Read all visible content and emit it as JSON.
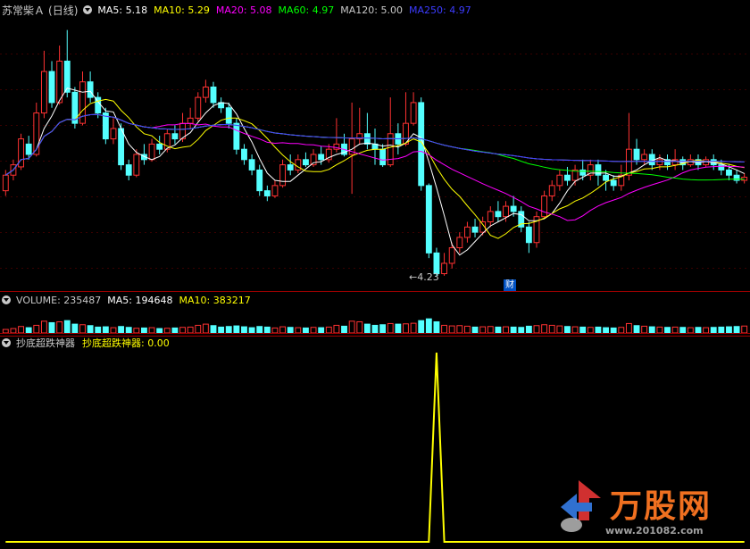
{
  "header": {
    "stock_name": "苏常柴Ａ",
    "period": "(日线)",
    "ma_items": [
      {
        "label": "MA5: 5.18",
        "color": "#ffffff"
      },
      {
        "label": "MA10: 5.29",
        "color": "#ffff00"
      },
      {
        "label": "MA20: 5.08",
        "color": "#ff00ff"
      },
      {
        "label": "MA60: 4.97",
        "color": "#00ff00"
      },
      {
        "label": "MA120: 5.00",
        "color": "#c8c8c8"
      },
      {
        "label": "MA250: 4.97",
        "color": "#3c3cff"
      }
    ]
  },
  "volume_panel": {
    "items": [
      {
        "label": "VOLUME: 235487",
        "color": "#c8c8c8"
      },
      {
        "label": "MA5: 194648",
        "color": "#ffffff"
      },
      {
        "label": "MA10: 383217",
        "color": "#ffff00"
      }
    ]
  },
  "indicator_panel": {
    "name": "抄底超跌神器",
    "value_label": "抄底超跌神器: 0.00",
    "color": "#ffff00"
  },
  "annotations": {
    "low_marker": "4.23",
    "finance_badge": "财"
  },
  "watermark": {
    "brand": "万股网",
    "url": "www.201082.com"
  },
  "chart_data": {
    "type": "candlestick",
    "price_range": [
      4.1,
      6.7
    ],
    "candles": [
      [
        5.05,
        5.2,
        5.0,
        5.25
      ],
      [
        5.2,
        5.3,
        5.15,
        5.35
      ],
      [
        5.28,
        5.55,
        5.25,
        5.6
      ],
      [
        5.5,
        5.4,
        5.35,
        5.58
      ],
      [
        5.4,
        5.8,
        5.38,
        5.9
      ],
      [
        5.8,
        6.2,
        5.75,
        6.4
      ],
      [
        6.2,
        5.9,
        5.85,
        6.3
      ],
      [
        5.9,
        6.3,
        5.88,
        6.45
      ],
      [
        6.3,
        6.0,
        5.95,
        6.6
      ],
      [
        6.0,
        5.7,
        5.65,
        6.05
      ],
      [
        5.7,
        6.1,
        5.68,
        6.2
      ],
      [
        6.1,
        5.95,
        5.9,
        6.2
      ],
      [
        5.95,
        5.8,
        5.75,
        6.0
      ],
      [
        5.8,
        5.55,
        5.5,
        5.85
      ],
      [
        5.55,
        5.65,
        5.5,
        5.75
      ],
      [
        5.65,
        5.3,
        5.25,
        5.7
      ],
      [
        5.3,
        5.2,
        5.15,
        5.35
      ],
      [
        5.2,
        5.4,
        5.18,
        5.45
      ],
      [
        5.4,
        5.35,
        5.3,
        5.5
      ],
      [
        5.35,
        5.5,
        5.33,
        5.55
      ],
      [
        5.5,
        5.45,
        5.4,
        5.58
      ],
      [
        5.45,
        5.6,
        5.42,
        5.65
      ],
      [
        5.6,
        5.55,
        5.5,
        5.68
      ],
      [
        5.55,
        5.7,
        5.52,
        5.8
      ],
      [
        5.7,
        5.75,
        5.65,
        5.85
      ],
      [
        5.75,
        5.95,
        5.72,
        6.0
      ],
      [
        5.95,
        6.05,
        5.9,
        6.12
      ],
      [
        6.05,
        5.9,
        5.85,
        6.1
      ],
      [
        5.9,
        5.85,
        5.8,
        5.95
      ],
      [
        5.85,
        5.7,
        5.65,
        5.9
      ],
      [
        5.7,
        5.45,
        5.4,
        5.75
      ],
      [
        5.45,
        5.35,
        5.3,
        5.5
      ],
      [
        5.35,
        5.25,
        5.2,
        5.4
      ],
      [
        5.25,
        5.05,
        5.0,
        5.3
      ],
      [
        5.05,
        5.0,
        4.95,
        5.1
      ],
      [
        5.0,
        5.1,
        4.98,
        5.15
      ],
      [
        5.1,
        5.3,
        5.08,
        5.35
      ],
      [
        5.3,
        5.25,
        5.2,
        5.4
      ],
      [
        5.25,
        5.35,
        5.22,
        5.4
      ],
      [
        5.35,
        5.3,
        5.28,
        5.42
      ],
      [
        5.3,
        5.4,
        5.28,
        5.45
      ],
      [
        5.4,
        5.35,
        5.3,
        5.48
      ],
      [
        5.35,
        5.45,
        5.32,
        5.5
      ],
      [
        5.45,
        5.5,
        5.42,
        5.75
      ],
      [
        5.5,
        5.4,
        5.38,
        5.6
      ],
      [
        5.4,
        5.55,
        5.02,
        5.9
      ],
      [
        5.55,
        5.6,
        5.5,
        5.85
      ],
      [
        5.6,
        5.5,
        5.45,
        5.8
      ],
      [
        5.5,
        5.45,
        5.3,
        5.65
      ],
      [
        5.45,
        5.3,
        5.28,
        5.5
      ],
      [
        5.3,
        5.6,
        5.28,
        5.95
      ],
      [
        5.6,
        5.5,
        5.4,
        5.7
      ],
      [
        5.5,
        5.7,
        5.48,
        6.0
      ],
      [
        5.7,
        5.9,
        5.68,
        6.0
      ],
      [
        5.9,
        5.1,
        5.05,
        5.95
      ],
      [
        5.1,
        4.45,
        4.4,
        5.12
      ],
      [
        4.45,
        4.25,
        4.23,
        4.5
      ],
      [
        4.25,
        4.35,
        4.23,
        4.45
      ],
      [
        4.35,
        4.5,
        4.3,
        4.55
      ],
      [
        4.5,
        4.6,
        4.45,
        4.65
      ],
      [
        4.6,
        4.7,
        4.55,
        4.75
      ],
      [
        4.7,
        4.65,
        4.6,
        4.78
      ],
      [
        4.65,
        4.75,
        4.62,
        4.8
      ],
      [
        4.75,
        4.85,
        4.7,
        4.9
      ],
      [
        4.85,
        4.8,
        4.75,
        4.95
      ],
      [
        4.8,
        4.9,
        4.75,
        4.95
      ],
      [
        4.9,
        4.85,
        4.8,
        5.0
      ],
      [
        4.85,
        4.7,
        4.65,
        4.9
      ],
      [
        4.7,
        4.55,
        4.45,
        4.75
      ],
      [
        4.55,
        4.8,
        4.5,
        4.85
      ],
      [
        4.8,
        5.0,
        4.78,
        5.05
      ],
      [
        5.0,
        5.1,
        4.95,
        5.15
      ],
      [
        5.1,
        5.2,
        5.05,
        5.25
      ],
      [
        5.2,
        5.15,
        5.1,
        5.28
      ],
      [
        5.15,
        5.25,
        5.1,
        5.3
      ],
      [
        5.25,
        5.2,
        5.15,
        5.35
      ],
      [
        5.2,
        5.3,
        5.15,
        5.35
      ],
      [
        5.3,
        5.2,
        5.1,
        5.35
      ],
      [
        5.2,
        5.15,
        5.05,
        5.25
      ],
      [
        5.15,
        5.1,
        5.05,
        5.2
      ],
      [
        5.1,
        5.2,
        5.05,
        5.3
      ],
      [
        5.2,
        5.45,
        5.15,
        5.8
      ],
      [
        5.45,
        5.35,
        5.3,
        5.55
      ],
      [
        5.35,
        5.4,
        5.3,
        5.45
      ],
      [
        5.4,
        5.3,
        5.25,
        5.45
      ],
      [
        5.3,
        5.35,
        5.25,
        5.4
      ],
      [
        5.35,
        5.3,
        5.25,
        5.4
      ],
      [
        5.3,
        5.35,
        5.25,
        5.45
      ],
      [
        5.35,
        5.3,
        5.25,
        5.38
      ],
      [
        5.3,
        5.35,
        5.28,
        5.4
      ],
      [
        5.35,
        5.3,
        5.25,
        5.4
      ],
      [
        5.3,
        5.35,
        5.28,
        5.38
      ],
      [
        5.35,
        5.3,
        5.25,
        5.4
      ],
      [
        5.3,
        5.25,
        5.2,
        5.35
      ],
      [
        5.25,
        5.2,
        5.15,
        5.3
      ],
      [
        5.2,
        5.15,
        5.12,
        5.25
      ],
      [
        5.15,
        5.18,
        5.12,
        5.22
      ]
    ],
    "volume_range": [
      0,
      1000000
    ],
    "volumes": [
      120000,
      150000,
      220000,
      180000,
      260000,
      400000,
      350000,
      380000,
      420000,
      300000,
      280000,
      250000,
      200000,
      210000,
      180000,
      220000,
      190000,
      160000,
      170000,
      180000,
      150000,
      160000,
      170000,
      190000,
      200000,
      260000,
      300000,
      250000,
      200000,
      220000,
      240000,
      210000,
      180000,
      220000,
      200000,
      170000,
      210000,
      190000,
      180000,
      170000,
      190000,
      180000,
      200000,
      260000,
      230000,
      400000,
      380000,
      300000,
      260000,
      280000,
      320000,
      300000,
      310000,
      330000,
      420000,
      480000,
      380000,
      260000,
      240000,
      250000,
      230000,
      200000,
      210000,
      220000,
      200000,
      210000,
      200000,
      190000,
      230000,
      250000,
      280000,
      260000,
      240000,
      220000,
      210000,
      200000,
      190000,
      200000,
      180000,
      170000,
      190000,
      320000,
      250000,
      230000,
      210000,
      200000,
      190000,
      200000,
      190000,
      180000,
      190000,
      180000,
      190000,
      200000,
      210000,
      220000,
      235487
    ],
    "indicator_range": [
      0,
      1
    ],
    "indicator_signal_index": 56,
    "indicator_peak": 1
  }
}
